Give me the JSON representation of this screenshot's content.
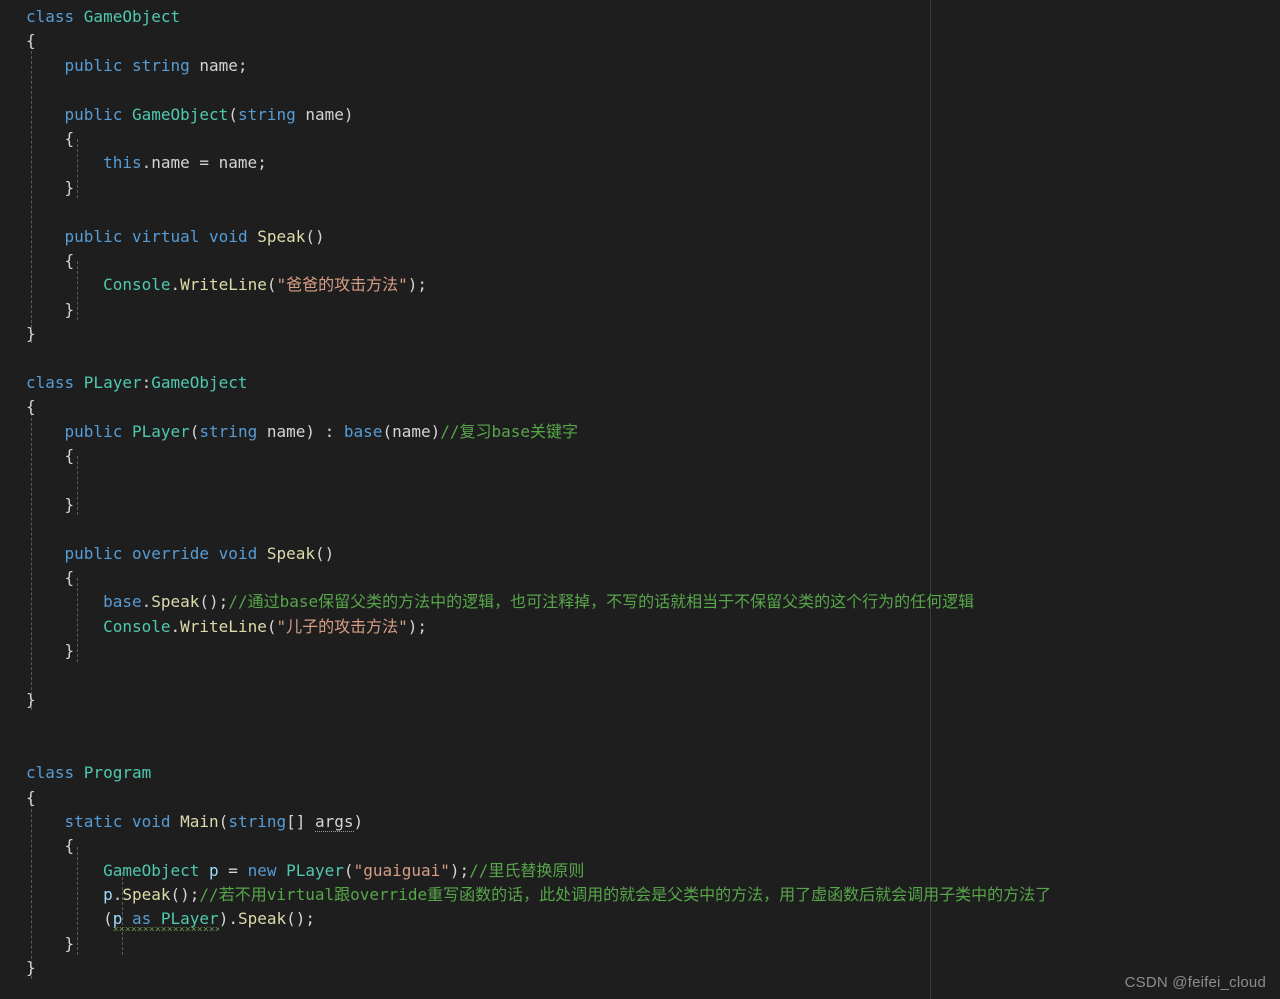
{
  "editor": {
    "language": "csharp",
    "background_color": "#1e1e1e",
    "foreground_color": "#d4d4d4",
    "ruler_column_color": "#3a3a3a",
    "indent_guide_color": "#5a5a5a",
    "font_size_px": 16,
    "line_height_px": 24.4,
    "token_colors": {
      "keyword": "#569cd6",
      "type": "#4ec9b0",
      "method": "#dcdcaa",
      "string": "#d69d85",
      "comment": "#57a64a",
      "variable": "#9cdcfe",
      "plain": "#d4d4d4"
    }
  },
  "code_lines": [
    "class GameObject",
    "{",
    "    public string name;",
    "",
    "    public GameObject(string name)",
    "    {",
    "        this.name = name;",
    "    }",
    "",
    "    public virtual void Speak()",
    "    {",
    "        Console.WriteLine(\"爸爸的攻击方法\");",
    "    }",
    "}",
    "",
    "class PLayer:GameObject",
    "{",
    "    public PLayer(string name) : base(name)//复习base关键字",
    "    {",
    "",
    "    }",
    "",
    "    public override void Speak()",
    "    {",
    "        base.Speak();//通过base保留父类的方法中的逻辑，也可注释掉，不写的话就相当于不保留父类的这个行为的任何逻辑",
    "        Console.WriteLine(\"儿子的攻击方法\");",
    "    }",
    "",
    "}",
    "",
    "",
    "class Program",
    "{",
    "    static void Main(string[] args)",
    "    {",
    "        GameObject p = new PLayer(\"guaiguai\");//里氏替换原则",
    "        p.Speak();//若不用virtual跟override重写函数的话，此处调用的就会是父类中的方法，用了虚函数后就会调用子类中的方法了",
    "        (p as PLayer).Speak();",
    "    }",
    "}"
  ],
  "tokens": {
    "kw_class": "class",
    "kw_public": "public",
    "kw_string": "string",
    "kw_void": "void",
    "kw_virtual": "virtual",
    "kw_override": "override",
    "kw_static": "static",
    "kw_new": "new",
    "kw_this": "this",
    "kw_base": "base",
    "kw_as": "as",
    "type_gameobject": "GameObject",
    "type_player": "PLayer",
    "type_console": "Console",
    "type_program": "Program",
    "fn_speak": "Speak",
    "fn_writeline": "WriteLine",
    "fn_main": "Main",
    "var_name": "name",
    "var_args": "args",
    "var_p": "p",
    "str_dad_attack": "\"爸爸的攻击方法\"",
    "str_son_attack": "\"儿子的攻击方法\"",
    "str_guaiguai": "\"guaiguai\"",
    "cmt_base_keyword": "//复习base关键字",
    "cmt_base_logic": "//通过base保留父类的方法中的逻辑，也可注释掉，不写的话就相当于不保留父类的这个行为的任何逻辑",
    "cmt_lsp": "//里氏替换原则",
    "cmt_virtual_override": "//若不用virtual跟override重写函数的话，此处调用的就会是父类中的方法，用了虚函数后就会调用子类中的方法了"
  },
  "punctuation": {
    "open_brace": "{",
    "close_brace": "}",
    "open_paren": "(",
    "close_paren": ")",
    "semicolon": ";",
    "colon": ":",
    "dot": ".",
    "equals": "=",
    "brackets": "[]",
    "space": " "
  },
  "line_pieces": {
    "l1_a": "class ",
    "l1_b": "GameObject",
    "l2": "{",
    "l3_a": "    ",
    "l3_b": "public",
    "l3_c": " ",
    "l3_d": "string",
    "l3_e": " name;",
    "l5_a": "    ",
    "l5_b": "public",
    "l5_c": " ",
    "l5_d": "GameObject",
    "l5_e": "(",
    "l5_f": "string",
    "l5_g": " ",
    "l5_h": "name",
    "l5_i": ")",
    "l6": "    {",
    "l7_a": "        ",
    "l7_b": "this",
    "l7_c": ".name = ",
    "l7_d": "name",
    "l7_e": ";",
    "l8": "    }",
    "l10_a": "    ",
    "l10_b": "public",
    "l10_c": " ",
    "l10_d": "virtual",
    "l10_e": " ",
    "l10_f": "void",
    "l10_g": " ",
    "l10_h": "Speak",
    "l10_i": "()",
    "l11": "    {",
    "l12_a": "        ",
    "l12_b": "Console",
    "l12_c": ".",
    "l12_d": "WriteLine",
    "l12_e": "(",
    "l12_f": "\"爸爸的攻击方法\"",
    "l12_g": ");",
    "l13": "    }",
    "l14": "}",
    "l16_a": "class ",
    "l16_b": "PLayer",
    "l16_c": ":",
    "l16_d": "GameObject",
    "l17": "{",
    "l18_a": "    ",
    "l18_b": "public",
    "l18_c": " ",
    "l18_d": "PLayer",
    "l18_e": "(",
    "l18_f": "string",
    "l18_g": " ",
    "l18_h": "name",
    "l18_i": ") : ",
    "l18_j": "base",
    "l18_k": "(",
    "l18_l": "name",
    "l18_m": ")",
    "l18_n": "//复习base关键字",
    "l19": "    {",
    "l21": "    }",
    "l23_a": "    ",
    "l23_b": "public",
    "l23_c": " ",
    "l23_d": "override",
    "l23_e": " ",
    "l23_f": "void",
    "l23_g": " ",
    "l23_h": "Speak",
    "l23_i": "()",
    "l24": "    {",
    "l25_a": "        ",
    "l25_b": "base",
    "l25_c": ".",
    "l25_d": "Speak",
    "l25_e": "();",
    "l25_f": "//通过base保留父类的方法中的逻辑，也可注释掉，不写的话就相当于不保留父类的这个行为的任何逻辑",
    "l26_a": "        ",
    "l26_b": "Console",
    "l26_c": ".",
    "l26_d": "WriteLine",
    "l26_e": "(",
    "l26_f": "\"儿子的攻击方法\"",
    "l26_g": ");",
    "l27": "    }",
    "l29": "}",
    "l32_a": "class ",
    "l32_b": "Program",
    "l33": "{",
    "l34_a": "    ",
    "l34_b": "static",
    "l34_c": " ",
    "l34_d": "void",
    "l34_e": " ",
    "l34_f": "Main",
    "l34_g": "(",
    "l34_h": "string",
    "l34_i": "[] ",
    "l34_j": "args",
    "l34_k": ")",
    "l35": "    {",
    "l36_a": "        ",
    "l36_b": "GameObject",
    "l36_c": " ",
    "l36_d": "p",
    "l36_e": " = ",
    "l36_f": "new",
    "l36_g": " ",
    "l36_h": "PLayer",
    "l36_i": "(",
    "l36_j": "\"guaiguai\"",
    "l36_k": ");",
    "l36_l": "//里氏替换原则",
    "l37_a": "        ",
    "l37_b": "p",
    "l37_c": ".",
    "l37_d": "Speak",
    "l37_e": "();",
    "l37_f": "//若不用virtual跟override重写函数的话，此处调用的就会是父类中的方法，用了虚函数后就会调用子类中的方法了",
    "l38_a": "        (",
    "l38_b": "p",
    "l38_c": " ",
    "l38_d": "as",
    "l38_e": " ",
    "l38_f": "PLayer",
    "l38_g": ").",
    "l38_h": "Speak",
    "l38_i": "();",
    "l39": "    }",
    "l40": "}"
  },
  "watermark": {
    "text": "CSDN @feifei_cloud",
    "color": "#8d8d8d"
  }
}
